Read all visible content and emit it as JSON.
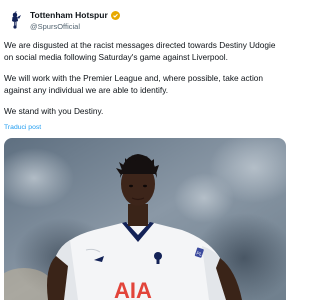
{
  "account": {
    "name": "Tottenham Hotspur",
    "handle": "@SpursOfficial",
    "verified_color": "#f4b400"
  },
  "tweet": {
    "paragraphs": [
      "We are disgusted at the racist messages directed towards Destiny Udogie on social media following Saturday's game against Liverpool.",
      "We will work with the Premier League and, where possible, take action against any individual we are able to identify.",
      "We stand with you Destiny."
    ],
    "translate_label": "Traduci post"
  },
  "photo": {
    "shirt_sponsor": "AIA",
    "sleeve_badge": "PL"
  },
  "colors": {
    "text": "#0f1419",
    "secondary": "#536471",
    "link": "#1d9bf0",
    "navy": "#132257"
  }
}
